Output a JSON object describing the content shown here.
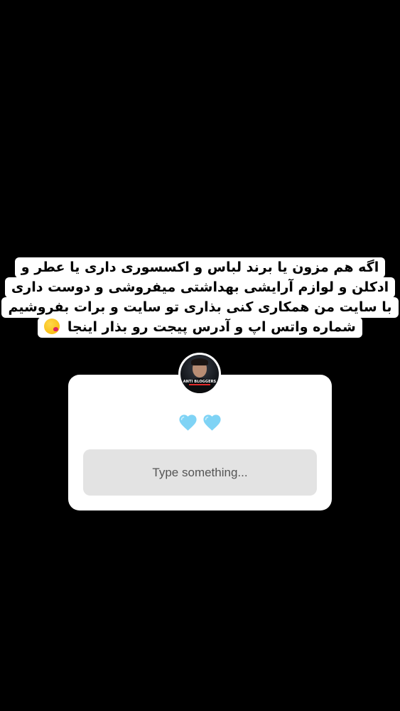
{
  "story": {
    "caption_lines": [
      "اگه هم مزون یا برند لباس و اکسسوری داری یا عطر و",
      "ادکلن و لوازم آرایشی بهداشتی میفروشی و دوست داری",
      "با سایت من همکاری کنی بذاری تو سایت و برات بفروشیم",
      "شماره واتس اپ و آدرس پیجت رو بذار اینجا"
    ],
    "caption_emoji": "face-blowing-a-kiss"
  },
  "question_sticker": {
    "avatar_label": "ANTI BLOGGERS",
    "prompt_emojis": [
      "light-blue-heart",
      "light-blue-heart"
    ],
    "input_placeholder": "Type something..."
  },
  "colors": {
    "background": "#000000",
    "card": "#ffffff",
    "input_bg": "#e3e3e3",
    "heart": "#7fd3f5"
  }
}
